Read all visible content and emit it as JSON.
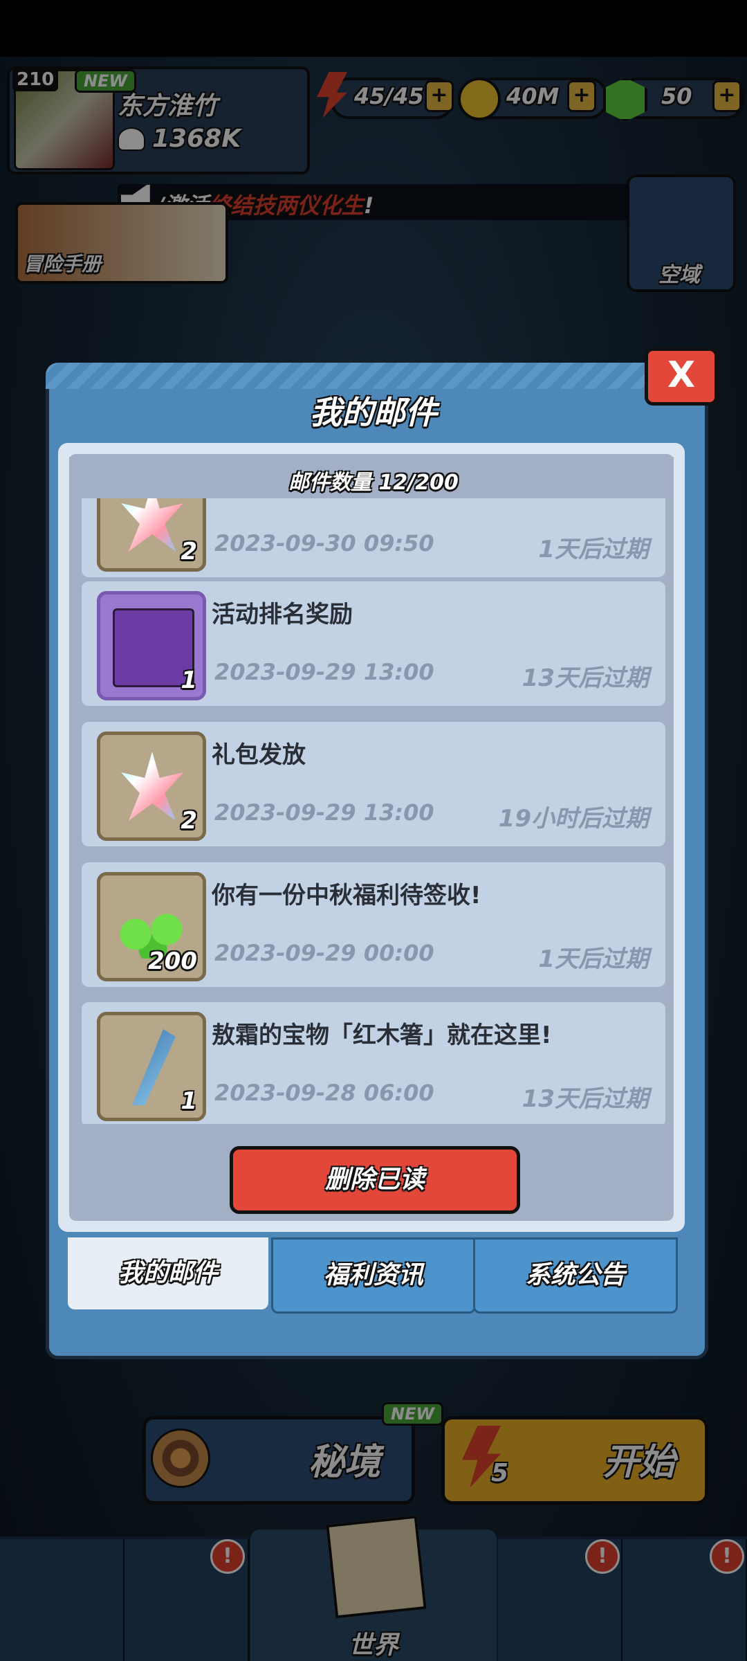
{
  "hud": {
    "level": "210",
    "new_badge": "NEW",
    "player_name": "东方淮竹",
    "power": "1368K",
    "energy": "45/45",
    "coins": "40M",
    "gems": "50",
    "plus": "+"
  },
  "marquee": {
    "prefix": "/激活",
    "highlight": "终结技两仪化生",
    "suffix": "!"
  },
  "side": {
    "adventure_book": "冒险手册",
    "airspace": "空域"
  },
  "modal": {
    "title": "我的邮件",
    "close_label": "X",
    "mail_count": "邮件数量 12/200",
    "mails": [
      {
        "title": "",
        "date": "2023-09-30 09:50",
        "expire": "1天后过期",
        "qty": "2",
        "icon": "crystal-icon"
      },
      {
        "title": "活动排名奖励",
        "date": "2023-09-29 13:00",
        "expire": "13天后过期",
        "qty": "1",
        "icon": "card-icon"
      },
      {
        "title": "礼包发放",
        "date": "2023-09-29 13:00",
        "expire": "19小时后过期",
        "qty": "2",
        "icon": "crystal-icon"
      },
      {
        "title": "你有一份中秋福利待签收!",
        "date": "2023-09-29 00:00",
        "expire": "1天后过期",
        "qty": "200",
        "icon": "gem-icon"
      },
      {
        "title": "敖霜的宝物「红木箸」就在这里!",
        "date": "2023-09-28 06:00",
        "expire": "13天后过期",
        "qty": "1",
        "icon": "chopsticks-icon"
      }
    ],
    "delete_read": "删除已读",
    "tabs": [
      "我的邮件",
      "福利资讯",
      "系统公告"
    ]
  },
  "bottom": {
    "secret_new": "NEW",
    "secret_realm": "秘境",
    "start": "开始",
    "start_cost": "5",
    "world": "世界",
    "badge": "!"
  },
  "colors": {
    "accent_red": "#e2473a",
    "panel_blue": "#4e88b8",
    "gold": "#eab027"
  }
}
